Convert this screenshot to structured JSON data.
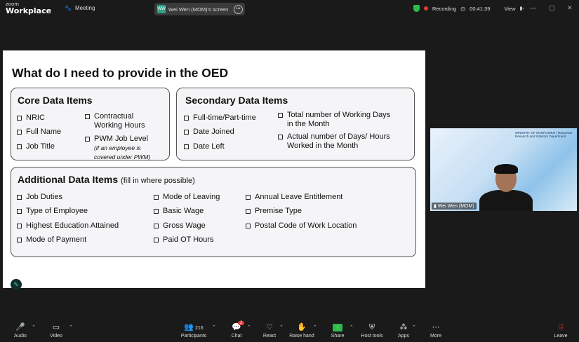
{
  "app": {
    "brand_top": "zoom",
    "brand_bottom": "Workplace",
    "meeting_label": "Meeting"
  },
  "screen_share": {
    "avatar_initials": "WW",
    "label": "Wei Wen (MOM)'s screen"
  },
  "status": {
    "recording_label": "Recording",
    "timer": "00:41:39",
    "view_label": "View"
  },
  "slide": {
    "title": "What do I need to provide in the OED",
    "core": {
      "title": "Core Data Items",
      "items": [
        "NRIC",
        "Full Name",
        "Job Title"
      ],
      "contractual": "Contractual Working Hours",
      "pwm_level": "PWM Job Level",
      "pwm_note": "(if an employee is covered under PWM)"
    },
    "secondary": {
      "title": "Secondary Data Items",
      "left_items": [
        "Full-time/Part-time",
        "Date Joined",
        "Date Left"
      ],
      "right_items": [
        "Total number of Working Days in the Month",
        "Actual number of Days/ Hours Worked in the Month"
      ]
    },
    "additional": {
      "title": "Additional Data Items",
      "subtitle": "(fill in where possible)",
      "col1": [
        "Job Duties",
        "Type of Employee",
        "Highest Education Attained",
        "Mode of Payment"
      ],
      "col2": [
        "Mode of Leaving",
        "Basic Wage",
        "Gross Wage",
        "Paid OT Hours"
      ],
      "col3": [
        "Annual Leave Entitlement",
        "Premise Type",
        "Postal Code of Work Location"
      ]
    }
  },
  "video": {
    "participant_name": "Wei Wen (MOM)",
    "brand_left": "MINISTRY OF MANPOWER",
    "brand_right": "Manpower Research and Statistics Department"
  },
  "toolbar": {
    "audio": "Audio",
    "video": "Video",
    "participants": "Participants",
    "participants_count": "216",
    "chat": "Chat",
    "chat_badge": "2",
    "react": "React",
    "raise_hand": "Raise hand",
    "share": "Share",
    "host_tools": "Host tools",
    "apps": "Apps",
    "more": "More",
    "leave": "Leave"
  },
  "colors": {
    "accent": "#2fbb4c",
    "recording": "#e53935",
    "leave": "#e53935"
  }
}
